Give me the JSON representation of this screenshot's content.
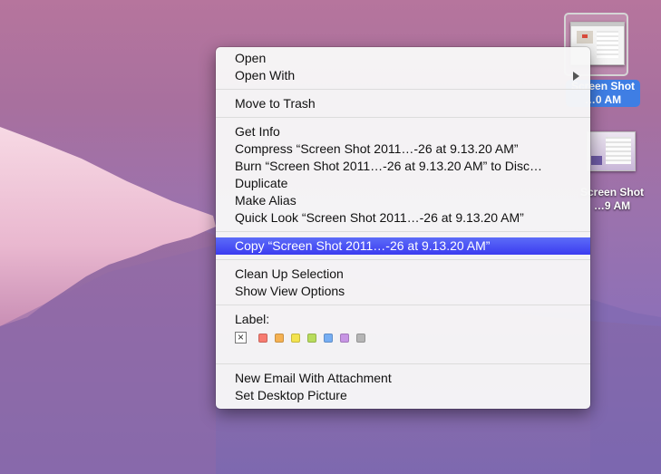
{
  "desktop": {
    "icons": [
      {
        "label_line1": "Screen Shot",
        "label_line2": "…0 AM",
        "selected": true
      },
      {
        "label_line1": "Screen Shot",
        "label_line2": "…9 AM",
        "selected": false
      }
    ]
  },
  "menu": {
    "group1": [
      "Open",
      "Open With"
    ],
    "group2": [
      "Move to Trash"
    ],
    "group3": [
      "Get Info",
      "Compress “Screen Shot 2011…-26 at 9.13.20 AM”",
      "Burn “Screen Shot 2011…-26 at 9.13.20 AM” to Disc…",
      "Duplicate",
      "Make Alias",
      "Quick Look “Screen Shot 2011…-26 at 9.13.20 AM”"
    ],
    "highlighted": "Copy “Screen Shot 2011…-26 at 9.13.20 AM”",
    "group5": [
      "Clean Up Selection",
      "Show View Options"
    ],
    "label_title": "Label:",
    "label_none_glyph": "×",
    "label_colors": [
      "#f77b70",
      "#f5b152",
      "#f3e34f",
      "#b8dc5c",
      "#76aef3",
      "#c795e4",
      "#b5b5b5"
    ],
    "group7": [
      "New Email With Attachment",
      "Set Desktop Picture"
    ]
  },
  "colors": {
    "highlight": "#3c3cf0",
    "selection_label": "#3f7ee4"
  }
}
